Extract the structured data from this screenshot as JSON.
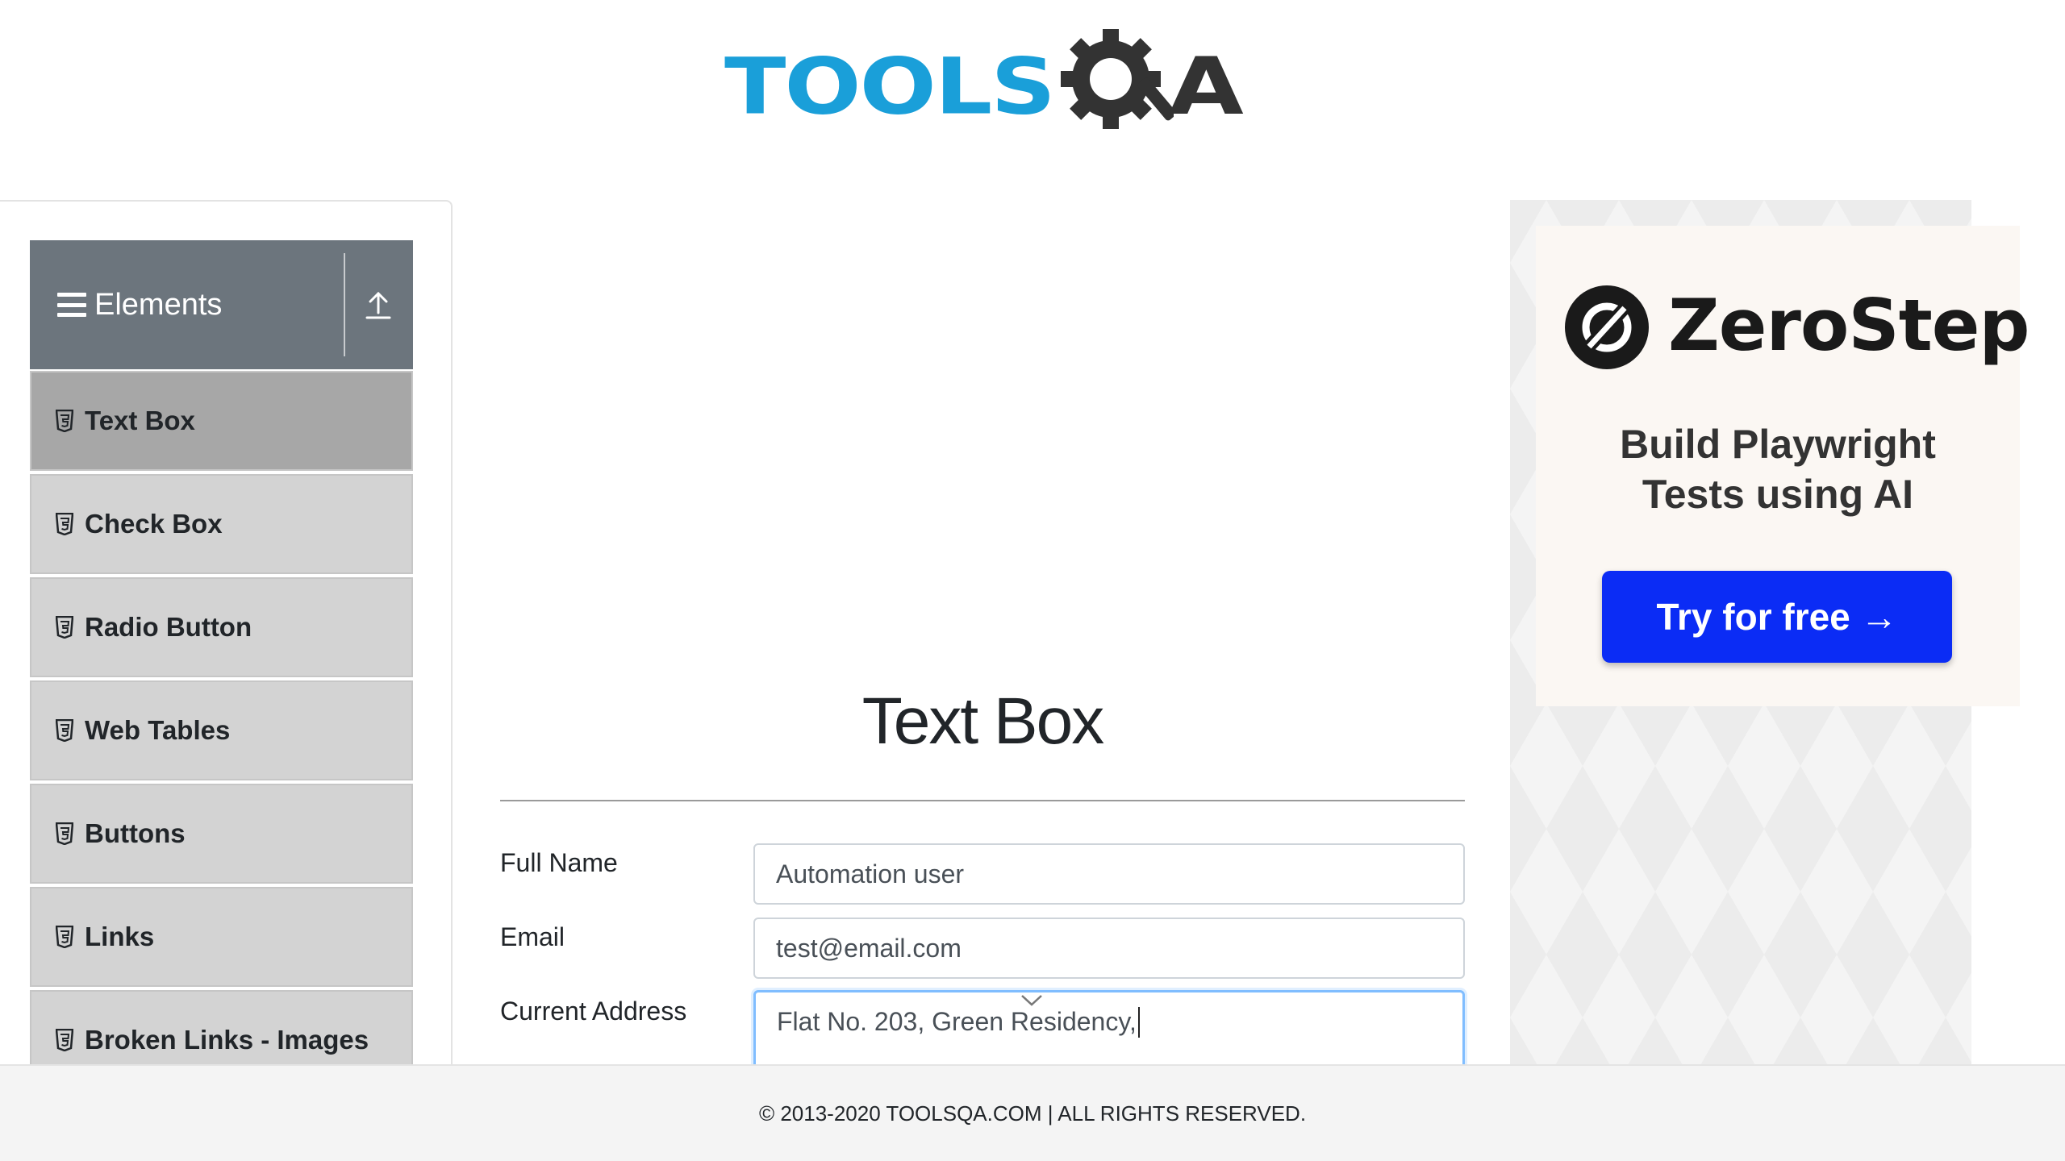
{
  "header": {
    "logo_text_left": "TOOLS",
    "logo_text_right": "A",
    "logo_icon": "gear-magnifier-icon"
  },
  "sidebar": {
    "group_title": "Elements",
    "group_icon": "hamburger-icon",
    "toggle_icon": "collapse-up-icon",
    "items": [
      {
        "label": "Text Box",
        "icon": "html5-icon",
        "active": true
      },
      {
        "label": "Check Box",
        "icon": "html5-icon",
        "active": false
      },
      {
        "label": "Radio Button",
        "icon": "html5-icon",
        "active": false
      },
      {
        "label": "Web Tables",
        "icon": "html5-icon",
        "active": false
      },
      {
        "label": "Buttons",
        "icon": "html5-icon",
        "active": false
      },
      {
        "label": "Links",
        "icon": "html5-icon",
        "active": false
      },
      {
        "label": "Broken Links - Images",
        "icon": "html5-icon",
        "active": false
      }
    ]
  },
  "main": {
    "title": "Text Box",
    "form": {
      "full_name_label": "Full Name",
      "full_name_value": "Automation user",
      "email_label": "Email",
      "email_value": "test@email.com",
      "address_label": "Current Address",
      "address_value": "Flat No. 203, Green Residency,"
    }
  },
  "ad": {
    "brand": "ZeroStep",
    "tagline_line1": "Build Playwright",
    "tagline_line2": "Tests using AI",
    "cta": "Try for free →",
    "cta_color": "#0b2cf5"
  },
  "footer": {
    "text": "© 2013-2020 TOOLSQA.COM | ALL RIGHTS RESERVED."
  },
  "colors": {
    "brand_blue": "#1a9fd9",
    "sidebar_header": "#6c757d",
    "menu_item": "#d3d3d3",
    "menu_item_active": "#a7a7a7"
  }
}
